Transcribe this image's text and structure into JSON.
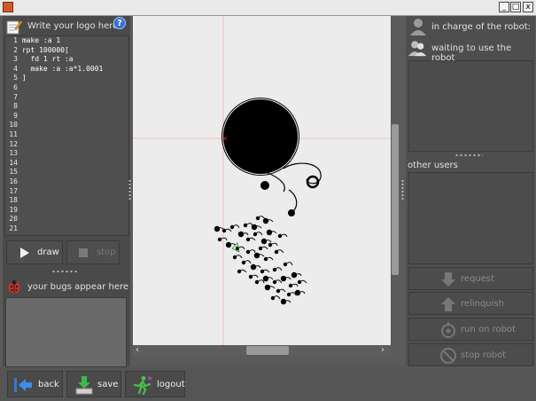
{
  "window": {
    "minimize_glyph": "_",
    "maximize_glyph": "□",
    "close_glyph": "x"
  },
  "editor_header": {
    "title": "Write your logo here",
    "help_glyph": "?"
  },
  "code_lines": [
    {
      "n": "1",
      "text": "make :a 1"
    },
    {
      "n": "2",
      "text": "rpt 100000["
    },
    {
      "n": "3",
      "text": "  fd 1 rt :a"
    },
    {
      "n": "4",
      "text": "  make :a :a*1.0001"
    },
    {
      "n": "5",
      "text": "]"
    },
    {
      "n": "6",
      "text": ""
    },
    {
      "n": "7",
      "text": ""
    },
    {
      "n": "8",
      "text": ""
    },
    {
      "n": "9",
      "text": ""
    },
    {
      "n": "10",
      "text": ""
    },
    {
      "n": "11",
      "text": ""
    },
    {
      "n": "12",
      "text": ""
    },
    {
      "n": "13",
      "text": ""
    },
    {
      "n": "14",
      "text": ""
    },
    {
      "n": "15",
      "text": ""
    },
    {
      "n": "16",
      "text": ""
    },
    {
      "n": "17",
      "text": ""
    },
    {
      "n": "18",
      "text": ""
    },
    {
      "n": "19",
      "text": ""
    },
    {
      "n": "20",
      "text": ""
    },
    {
      "n": "21",
      "text": ""
    }
  ],
  "controls": {
    "draw_label": "draw",
    "stop_label": "stop"
  },
  "bugs": {
    "label": "your bugs appear here"
  },
  "robot": {
    "in_charge_label": "in charge of the robot:",
    "waiting_label": "waiting to use the robot"
  },
  "other_users": {
    "label": "other users"
  },
  "robot_actions": {
    "request_label": "request",
    "relinquish_label": "relinquish",
    "run_label": "run on robot",
    "stop_label": "stop robot"
  },
  "bottom": {
    "back_label": "back",
    "save_label": "save",
    "logout_label": "logout"
  },
  "colors": {
    "accent_blue": "#3a6fd0",
    "bug_red": "#c8322a",
    "guide_line": "#f2b0b0",
    "turtle_mark": "#d02020"
  }
}
